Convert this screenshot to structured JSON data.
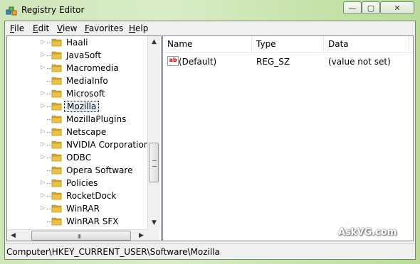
{
  "window": {
    "title": "Registry Editor",
    "min_label": "—",
    "max_label": "▢",
    "close_label": "✕"
  },
  "menu": [
    {
      "key": "F",
      "rest": "ile"
    },
    {
      "key": "E",
      "rest": "dit"
    },
    {
      "key": "V",
      "rest": "iew"
    },
    {
      "key": "F",
      "rest": "avorites",
      "prefix": ""
    },
    {
      "key": "H",
      "rest": "elp"
    }
  ],
  "tree": {
    "items": [
      {
        "label": "Haali",
        "expandable": true
      },
      {
        "label": "JavaSoft",
        "expandable": true
      },
      {
        "label": "Macromedia",
        "expandable": true
      },
      {
        "label": "MediaInfo",
        "expandable": false
      },
      {
        "label": "Microsoft",
        "expandable": true
      },
      {
        "label": "Mozilla",
        "expandable": true,
        "selected": true
      },
      {
        "label": "MozillaPlugins",
        "expandable": false
      },
      {
        "label": "Netscape",
        "expandable": true
      },
      {
        "label": "NVIDIA Corporation",
        "expandable": true
      },
      {
        "label": "ODBC",
        "expandable": true
      },
      {
        "label": "Opera Software",
        "expandable": false
      },
      {
        "label": "Policies",
        "expandable": true
      },
      {
        "label": "RocketDock",
        "expandable": true
      },
      {
        "label": "WinRAR",
        "expandable": true
      },
      {
        "label": "WinRAR SFX",
        "expandable": false
      }
    ],
    "hscroll_grip": "III"
  },
  "list": {
    "columns": [
      "Name",
      "Type",
      "Data"
    ],
    "rows": [
      {
        "icon": "ab",
        "name": "(Default)",
        "type": "REG_SZ",
        "data": "(value not set)"
      }
    ]
  },
  "status": {
    "path": "Computer\\HKEY_CURRENT_USER\\Software\\Mozilla"
  },
  "watermark": "AskVG.com",
  "colors": {
    "folder": "#e8c24a",
    "selection": "#e8f0fb",
    "frame": "#c4e0a8"
  }
}
